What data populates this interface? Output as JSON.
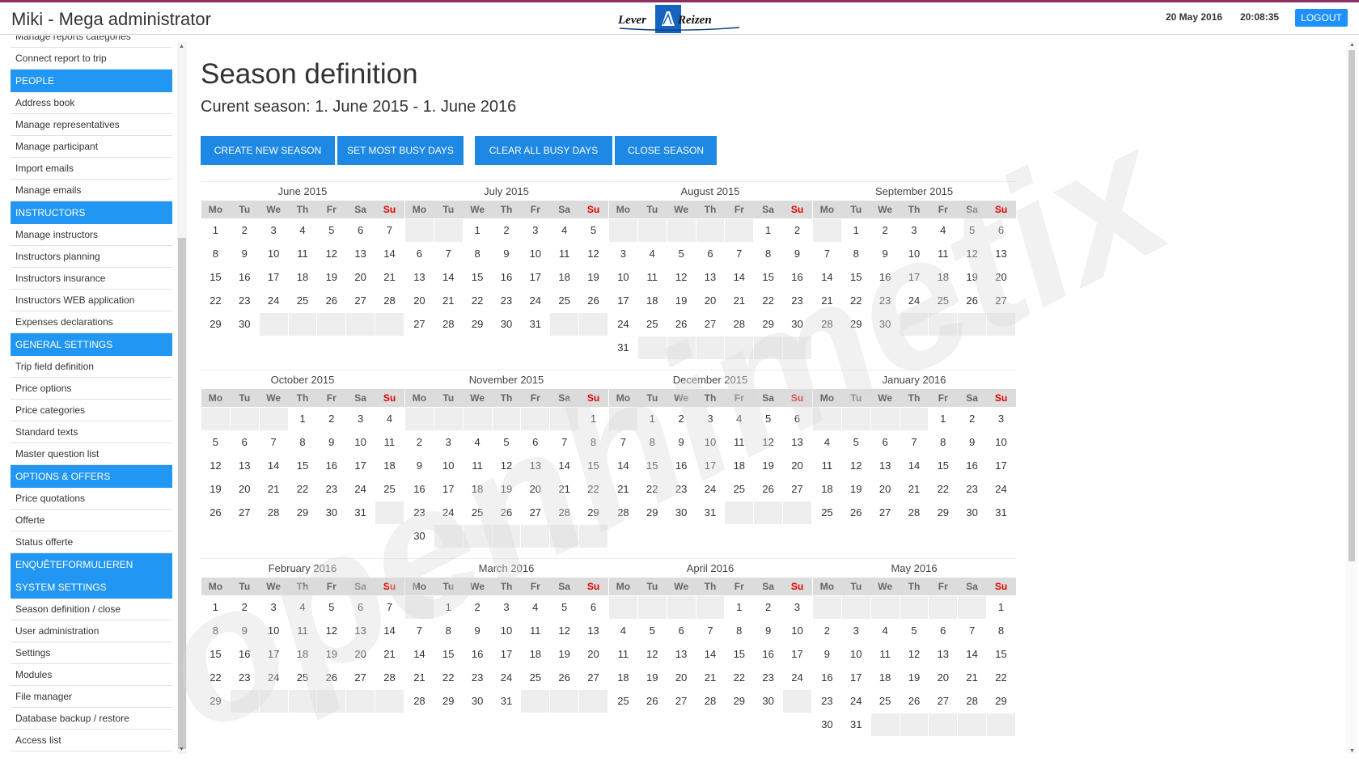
{
  "header": {
    "app_title": "Miki - Mega administrator",
    "logo_text_left": "Lever",
    "logo_text_right": "Reizen",
    "date": "20 May 2016",
    "time": "20:08:35",
    "logout_label": "LOGOUT"
  },
  "sidebar": {
    "items": [
      {
        "type": "item",
        "label": "Manage reports categories"
      },
      {
        "type": "item",
        "label": "Connect report to trip"
      },
      {
        "type": "header",
        "label": "PEOPLE"
      },
      {
        "type": "item",
        "label": "Address book"
      },
      {
        "type": "item",
        "label": "Manage representatives"
      },
      {
        "type": "item",
        "label": "Manage participant"
      },
      {
        "type": "item",
        "label": "Import emails"
      },
      {
        "type": "item",
        "label": "Manage emails"
      },
      {
        "type": "header",
        "label": "INSTRUCTORS"
      },
      {
        "type": "item",
        "label": "Manage instructors"
      },
      {
        "type": "item",
        "label": "Instructors planning"
      },
      {
        "type": "item",
        "label": "Instructors insurance"
      },
      {
        "type": "item",
        "label": "Instructors WEB application"
      },
      {
        "type": "item",
        "label": "Expenses declarations"
      },
      {
        "type": "header",
        "label": "GENERAL SETTINGS"
      },
      {
        "type": "item",
        "label": "Trip field definition"
      },
      {
        "type": "item",
        "label": "Price options"
      },
      {
        "type": "item",
        "label": "Price categories"
      },
      {
        "type": "item",
        "label": "Standard texts"
      },
      {
        "type": "item",
        "label": "Master question list"
      },
      {
        "type": "header",
        "label": "OPTIONS & OFFERS"
      },
      {
        "type": "item",
        "label": "Price quotations"
      },
      {
        "type": "item",
        "label": "Offerte"
      },
      {
        "type": "item",
        "label": "Status offerte"
      },
      {
        "type": "header",
        "label": "ENQUÊTEFORMULIEREN"
      },
      {
        "type": "header",
        "label": "SYSTEM SETTINGS"
      },
      {
        "type": "item",
        "label": "Season definition / close"
      },
      {
        "type": "item",
        "label": "User administration"
      },
      {
        "type": "item",
        "label": "Settings"
      },
      {
        "type": "item",
        "label": "Modules"
      },
      {
        "type": "item",
        "label": "File manager"
      },
      {
        "type": "item",
        "label": "Database backup / restore"
      },
      {
        "type": "item",
        "label": "Access list"
      }
    ]
  },
  "main": {
    "title": "Season definition",
    "subtitle": "Curent season: 1. June 2015 - 1. June 2016",
    "buttons": [
      "CREATE NEW SEASON",
      "SET MOST BUSY DAYS",
      "CLEAR ALL BUSY DAYS",
      "CLOSE SEASON"
    ],
    "weekdays": [
      "Mo",
      "Tu",
      "We",
      "Th",
      "Fr",
      "Sa",
      "Su"
    ],
    "calendars": [
      {
        "title": "June 2015",
        "offset": 0,
        "days": 30
      },
      {
        "title": "July 2015",
        "offset": 2,
        "days": 31
      },
      {
        "title": "August 2015",
        "offset": 5,
        "days": 31
      },
      {
        "title": "September 2015",
        "offset": 1,
        "days": 30
      },
      {
        "title": "October 2015",
        "offset": 3,
        "days": 31
      },
      {
        "title": "November 2015",
        "offset": 6,
        "days": 30
      },
      {
        "title": "December 2015",
        "offset": 1,
        "days": 31
      },
      {
        "title": "January 2016",
        "offset": 4,
        "days": 31
      },
      {
        "title": "February 2016",
        "offset": 0,
        "days": 29
      },
      {
        "title": "March 2016",
        "offset": 1,
        "days": 31
      },
      {
        "title": "April 2016",
        "offset": 4,
        "days": 30
      },
      {
        "title": "May 2016",
        "offset": 6,
        "days": 31
      }
    ]
  },
  "watermark": "openhimetix",
  "colors": {
    "accent": "#2196f3",
    "button": "#1e88e5",
    "sunday": "#e00000",
    "topline": "#8e2f62"
  }
}
